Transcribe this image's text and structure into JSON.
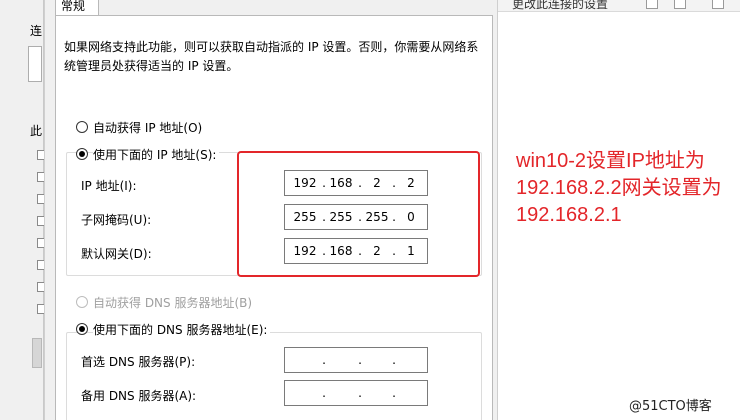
{
  "background_left": {
    "label_top": "连",
    "label_mid": "此"
  },
  "background_right": {
    "text": "更改此连接的设置"
  },
  "dialog": {
    "tab_general": "常规",
    "intro_text": "如果网络支持此功能，则可以获取自动指派的 IP 设置。否则，你需要从网络系统管理员处获得适当的 IP 设置。",
    "ip_auto_label": "自动获得 IP 地址(O)",
    "ip_manual_label": "使用下面的 IP 地址(S):",
    "ip_mode_selected": "manual",
    "ip_address_label": "IP 地址(I):",
    "subnet_label": "子网掩码(U):",
    "gateway_label": "默认网关(D):",
    "ip_address": [
      "192",
      "168",
      "2",
      "2"
    ],
    "subnet_mask": [
      "255",
      "255",
      "255",
      "0"
    ],
    "gateway": [
      "192",
      "168",
      "2",
      "1"
    ],
    "dns_auto_label": "自动获得 DNS 服务器地址(B)",
    "dns_manual_label": "使用下面的 DNS 服务器地址(E):",
    "dns_mode_selected": "manual",
    "dns_preferred_label": "首选 DNS 服务器(P):",
    "dns_alternate_label": "备用 DNS 服务器(A):",
    "dns_preferred": [
      "",
      "",
      "",
      ""
    ],
    "dns_alternate": [
      "",
      "",
      "",
      ""
    ]
  },
  "annotation": {
    "line1": "win10-2设置IP地址为",
    "line2": "192.168.2.2网关设置为",
    "line3": "192.168.2.1",
    "color": "#e3262a"
  },
  "watermark": "@51CTO博客"
}
